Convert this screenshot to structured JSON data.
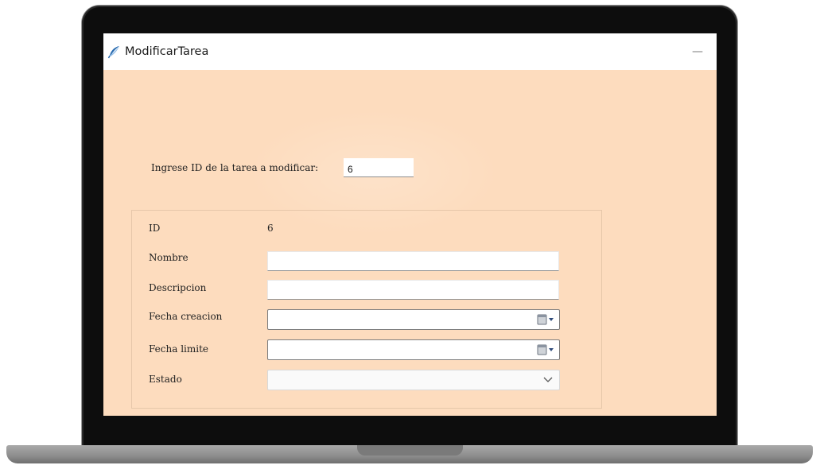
{
  "window": {
    "title": "ModificarTarea",
    "minimize_label": "—"
  },
  "search": {
    "label": "Ingrese ID de la tarea a modificar:",
    "value": "6"
  },
  "form": {
    "id_label": "ID",
    "id_value": "6",
    "nombre_label": "Nombre",
    "nombre_value": "",
    "descripcion_label": "Descripcion",
    "descripcion_value": "",
    "fecha_creacion_label": "Fecha creacion",
    "fecha_limite_label": "Fecha limite",
    "estado_label": "Estado"
  },
  "icons": {
    "app": "feather-pen-icon",
    "calendar": "calendar-icon",
    "dropdown": "chevron-down-icon"
  },
  "colors": {
    "window_background": "#fddcbe",
    "title_bar": "#ffffff",
    "app_icon": "#2b6cb0"
  }
}
